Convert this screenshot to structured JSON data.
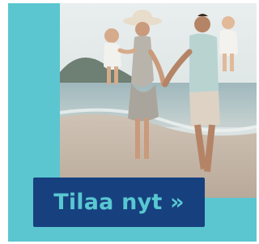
{
  "ad": {
    "cta_label": "Tilaa nyt »"
  },
  "colors": {
    "panel": "#5bc6cf",
    "cta_background": "#17407f",
    "cta_text": "#59c8d1"
  },
  "photo": {
    "description_icon": "family-beach-photo"
  }
}
